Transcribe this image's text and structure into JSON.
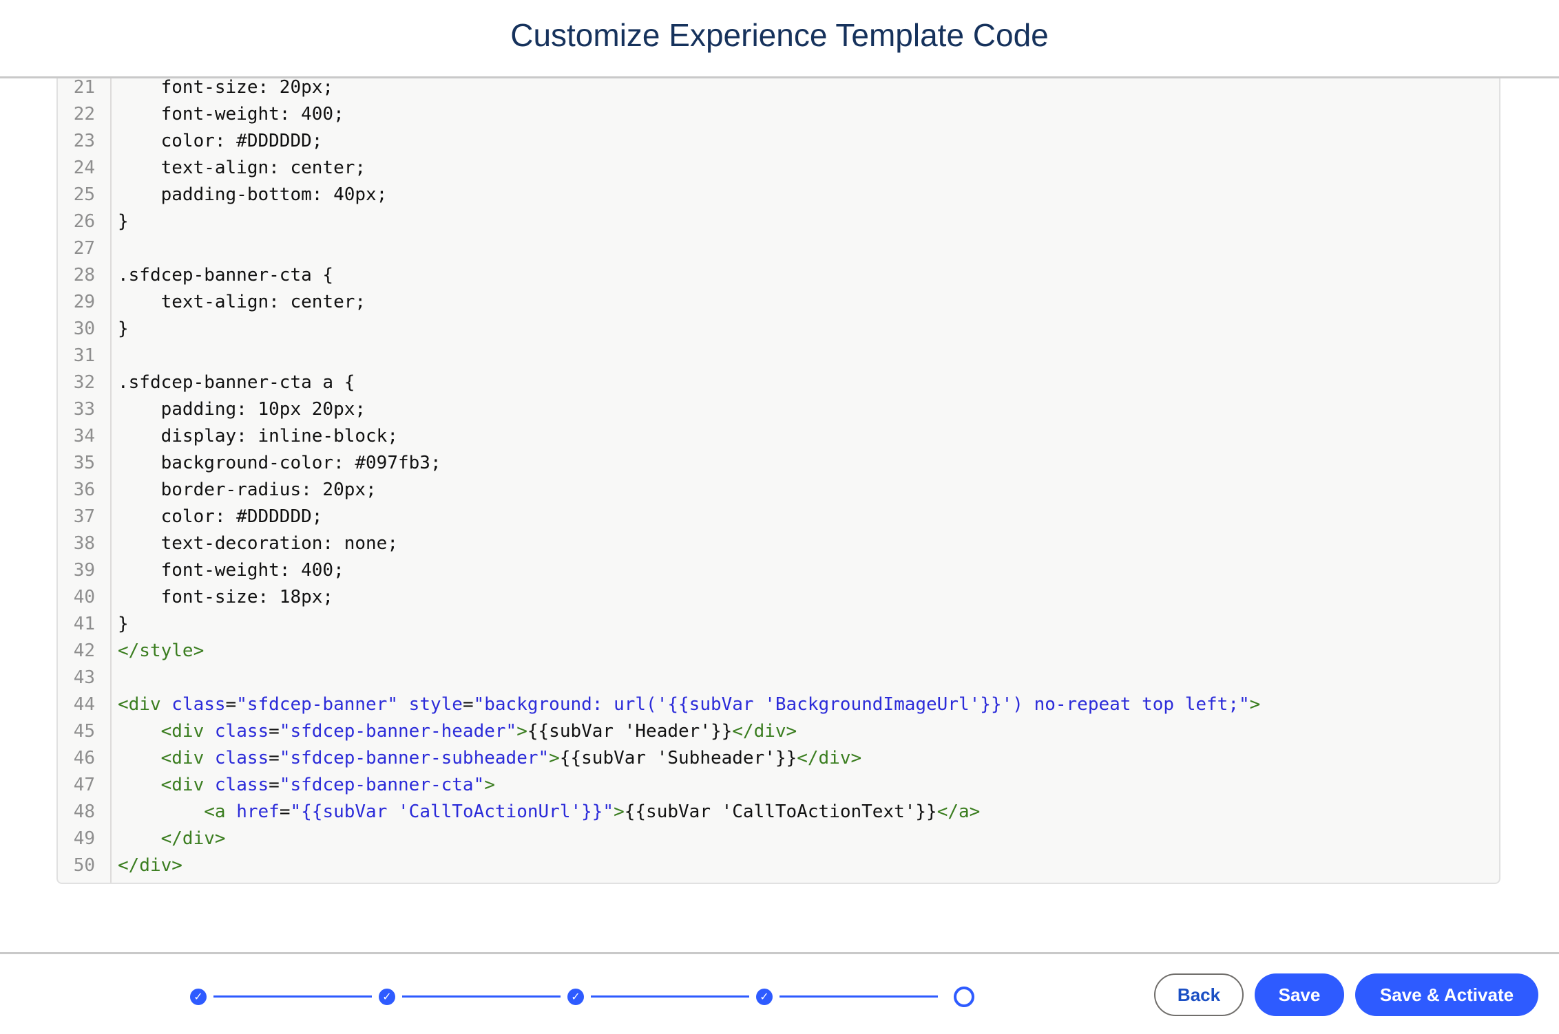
{
  "header": {
    "title": "Customize Experience Template Code"
  },
  "editor": {
    "lines": [
      {
        "n": "21",
        "segs": [
          [
            "    font-size: 20px;",
            "t"
          ]
        ]
      },
      {
        "n": "22",
        "segs": [
          [
            "    font-weight: 400;",
            "t"
          ]
        ]
      },
      {
        "n": "23",
        "segs": [
          [
            "    color: #DDDDDD;",
            "t"
          ]
        ]
      },
      {
        "n": "24",
        "segs": [
          [
            "    text-align: center;",
            "t"
          ]
        ]
      },
      {
        "n": "25",
        "segs": [
          [
            "    padding-bottom: 40px;",
            "t"
          ]
        ]
      },
      {
        "n": "26",
        "segs": [
          [
            "}",
            "t"
          ]
        ]
      },
      {
        "n": "27",
        "segs": []
      },
      {
        "n": "28",
        "segs": [
          [
            ".sfdcep-banner-cta {",
            "t"
          ]
        ]
      },
      {
        "n": "29",
        "segs": [
          [
            "    text-align: center;",
            "t"
          ]
        ]
      },
      {
        "n": "30",
        "segs": [
          [
            "}",
            "t"
          ]
        ]
      },
      {
        "n": "31",
        "segs": []
      },
      {
        "n": "32",
        "segs": [
          [
            ".sfdcep-banner-cta a {",
            "t"
          ]
        ]
      },
      {
        "n": "33",
        "segs": [
          [
            "    padding: 10px 20px;",
            "t"
          ]
        ]
      },
      {
        "n": "34",
        "segs": [
          [
            "    display: inline-block;",
            "t"
          ]
        ]
      },
      {
        "n": "35",
        "segs": [
          [
            "    background-color: #097fb3;",
            "t"
          ]
        ]
      },
      {
        "n": "36",
        "segs": [
          [
            "    border-radius: 20px;",
            "t"
          ]
        ]
      },
      {
        "n": "37",
        "segs": [
          [
            "    color: #DDDDDD;",
            "t"
          ]
        ]
      },
      {
        "n": "38",
        "segs": [
          [
            "    text-decoration: none;",
            "t"
          ]
        ]
      },
      {
        "n": "39",
        "segs": [
          [
            "    font-weight: 400;",
            "t"
          ]
        ]
      },
      {
        "n": "40",
        "segs": [
          [
            "    font-size: 18px;",
            "t"
          ]
        ]
      },
      {
        "n": "41",
        "segs": [
          [
            "}",
            "t"
          ]
        ]
      },
      {
        "n": "42",
        "segs": [
          [
            "</style>",
            "tag"
          ]
        ]
      },
      {
        "n": "43",
        "segs": []
      },
      {
        "n": "44",
        "segs": [
          [
            "<div",
            "tag"
          ],
          [
            " class",
            "attr"
          ],
          [
            "=",
            "t"
          ],
          [
            "\"sfdcep-banner\"",
            "val"
          ],
          [
            " style",
            "attr"
          ],
          [
            "=",
            "t"
          ],
          [
            "\"background: url('{{subVar 'BackgroundImageUrl'}}') no-repeat top left;\"",
            "val"
          ],
          [
            ">",
            "tag"
          ]
        ]
      },
      {
        "n": "45",
        "segs": [
          [
            "    ",
            "t"
          ],
          [
            "<div",
            "tag"
          ],
          [
            " class",
            "attr"
          ],
          [
            "=",
            "t"
          ],
          [
            "\"sfdcep-banner-header\"",
            "val"
          ],
          [
            ">",
            "tag"
          ],
          [
            "{{subVar 'Header'}}",
            "t"
          ],
          [
            "</div>",
            "tag"
          ]
        ]
      },
      {
        "n": "46",
        "segs": [
          [
            "    ",
            "t"
          ],
          [
            "<div",
            "tag"
          ],
          [
            " class",
            "attr"
          ],
          [
            "=",
            "t"
          ],
          [
            "\"sfdcep-banner-subheader\"",
            "val"
          ],
          [
            ">",
            "tag"
          ],
          [
            "{{subVar 'Subheader'}}",
            "t"
          ],
          [
            "</div>",
            "tag"
          ]
        ]
      },
      {
        "n": "47",
        "segs": [
          [
            "    ",
            "t"
          ],
          [
            "<div",
            "tag"
          ],
          [
            " class",
            "attr"
          ],
          [
            "=",
            "t"
          ],
          [
            "\"sfdcep-banner-cta\"",
            "val"
          ],
          [
            ">",
            "tag"
          ]
        ]
      },
      {
        "n": "48",
        "segs": [
          [
            "        ",
            "t"
          ],
          [
            "<a",
            "tag"
          ],
          [
            " href",
            "attr"
          ],
          [
            "=",
            "t"
          ],
          [
            "\"{{subVar 'CallToActionUrl'}}\"",
            "val"
          ],
          [
            ">",
            "tag"
          ],
          [
            "{{subVar 'CallToActionText'}}",
            "t"
          ],
          [
            "</a>",
            "tag"
          ]
        ]
      },
      {
        "n": "49",
        "segs": [
          [
            "    ",
            "t"
          ],
          [
            "</div>",
            "tag"
          ]
        ]
      },
      {
        "n": "50",
        "segs": [
          [
            "</div>",
            "tag"
          ]
        ]
      }
    ]
  },
  "progress": {
    "steps_total": 5,
    "steps_completed": 4,
    "current_step": 5,
    "check_icon": "check-icon",
    "accent_color": "#2e5bff"
  },
  "footer": {
    "back_label": "Back",
    "save_label": "Save",
    "save_activate_label": "Save & Activate"
  }
}
